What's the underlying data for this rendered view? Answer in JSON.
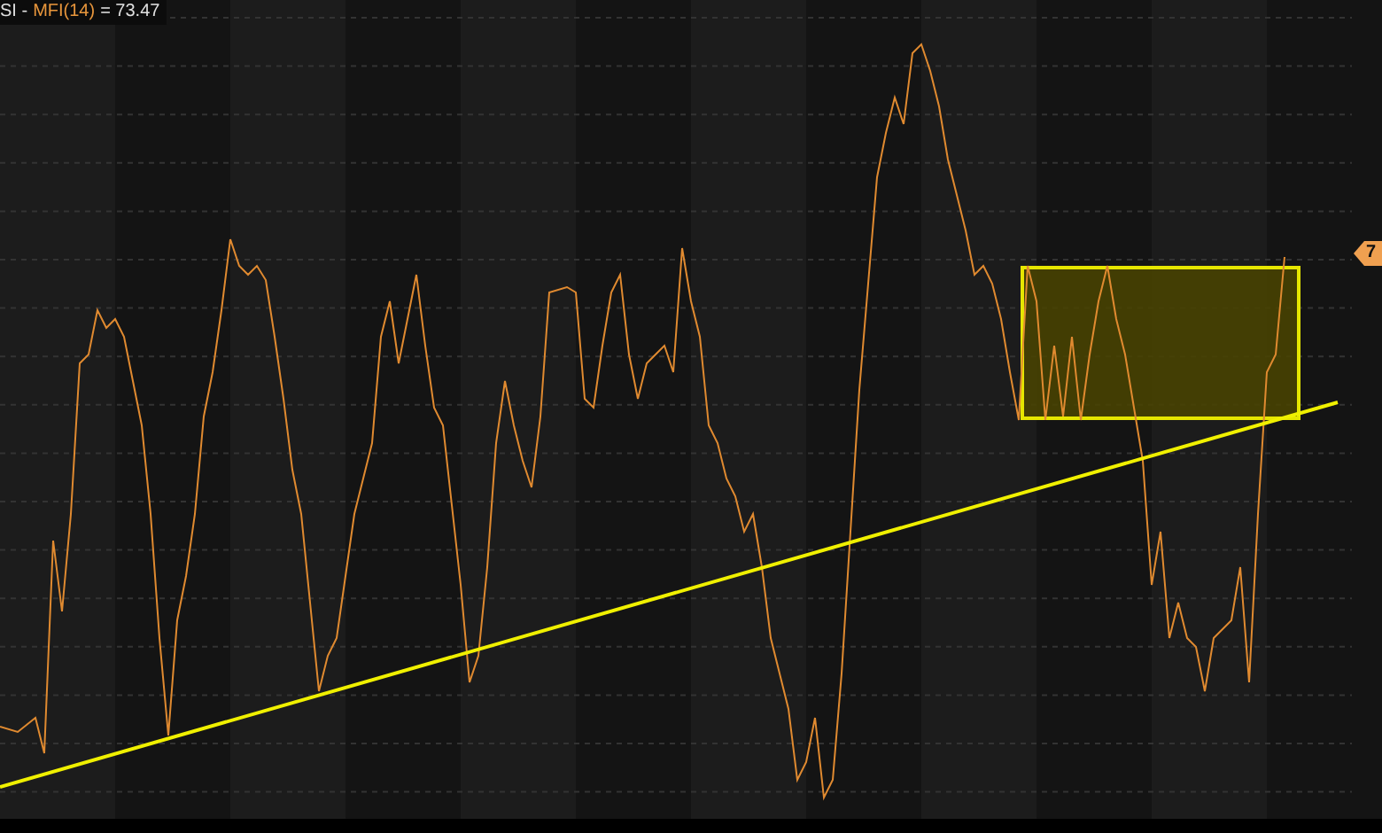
{
  "indicator_label": {
    "prefix": "SI -",
    "name": "MFI(14)",
    "value": "= 73.47"
  },
  "value_tag": "7"
}
